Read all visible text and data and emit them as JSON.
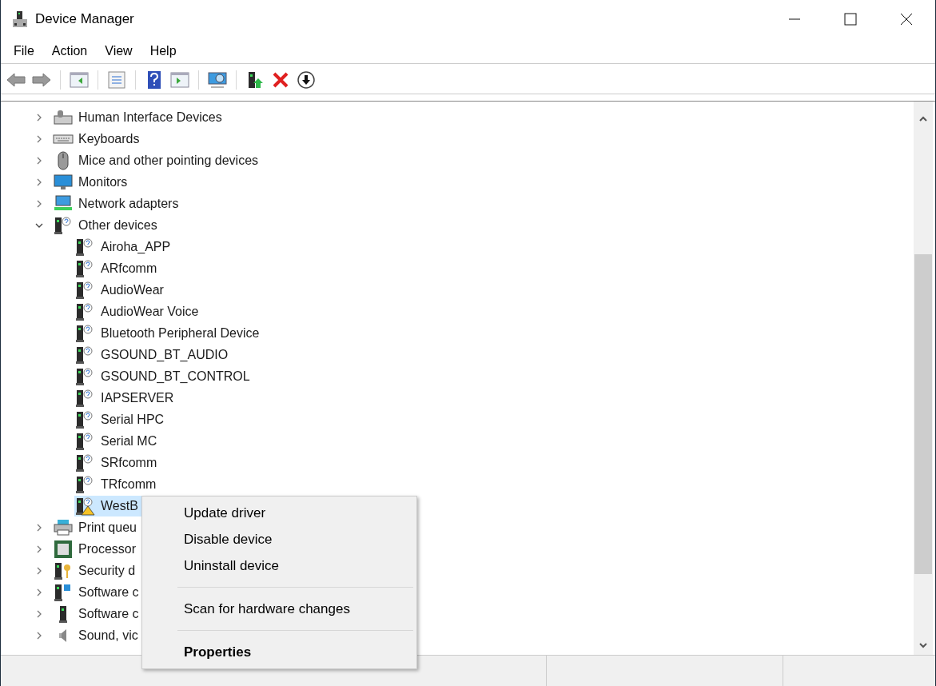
{
  "window": {
    "title": "Device Manager"
  },
  "menu": [
    "File",
    "Action",
    "View",
    "Help"
  ],
  "tree": [
    {
      "label": "Human Interface Devices",
      "kind": "hid",
      "expanded": false
    },
    {
      "label": "Keyboards",
      "kind": "keyboard",
      "expanded": false
    },
    {
      "label": "Mice and other pointing devices",
      "kind": "mouse",
      "expanded": false
    },
    {
      "label": "Monitors",
      "kind": "monitor",
      "expanded": false
    },
    {
      "label": "Network adapters",
      "kind": "network",
      "expanded": false
    },
    {
      "label": "Other devices",
      "kind": "unknown",
      "expanded": true,
      "children": [
        {
          "label": "Airoha_APP",
          "problem": false,
          "selected": false
        },
        {
          "label": "ARfcomm",
          "problem": false,
          "selected": false
        },
        {
          "label": "AudioWear",
          "problem": false,
          "selected": false
        },
        {
          "label": "AudioWear Voice",
          "problem": false,
          "selected": false
        },
        {
          "label": "Bluetooth Peripheral Device",
          "problem": false,
          "selected": false
        },
        {
          "label": "GSOUND_BT_AUDIO",
          "problem": false,
          "selected": false
        },
        {
          "label": "GSOUND_BT_CONTROL",
          "problem": false,
          "selected": false
        },
        {
          "label": "IAPSERVER",
          "problem": false,
          "selected": false
        },
        {
          "label": "Serial HPC",
          "problem": false,
          "selected": false
        },
        {
          "label": "Serial MC",
          "problem": false,
          "selected": false
        },
        {
          "label": "SRfcomm",
          "problem": false,
          "selected": false
        },
        {
          "label": "TRfcomm",
          "problem": false,
          "selected": false
        },
        {
          "label": "WestB",
          "problem": true,
          "selected": true
        }
      ]
    },
    {
      "label": "Print queu",
      "kind": "printer",
      "expanded": false
    },
    {
      "label": "Processor",
      "kind": "processor",
      "expanded": false
    },
    {
      "label": "Security d",
      "kind": "security",
      "expanded": false
    },
    {
      "label": "Software c",
      "kind": "software-plus",
      "expanded": false
    },
    {
      "label": "Software c",
      "kind": "software",
      "expanded": false
    },
    {
      "label": "Sound, vic",
      "kind": "sound",
      "expanded": false
    }
  ],
  "context_menu": [
    {
      "label": "Update driver",
      "kind": "item",
      "default": false
    },
    {
      "label": "Disable device",
      "kind": "item",
      "default": false
    },
    {
      "label": "Uninstall device",
      "kind": "item",
      "default": false
    },
    {
      "kind": "separator"
    },
    {
      "label": "Scan for hardware changes",
      "kind": "item",
      "default": false
    },
    {
      "kind": "separator"
    },
    {
      "label": "Properties",
      "kind": "item",
      "default": true
    }
  ]
}
